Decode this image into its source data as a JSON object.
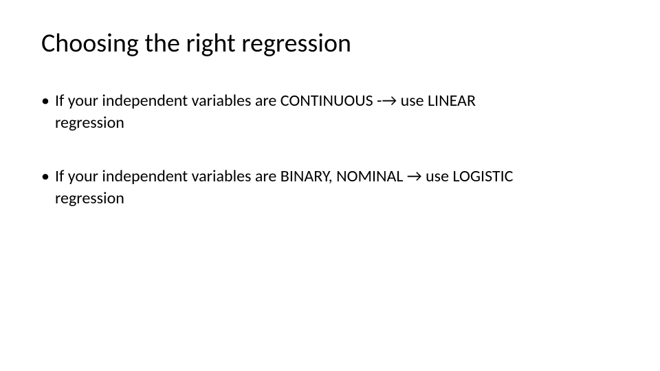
{
  "title": "Choosing the right regression",
  "bullets": [
    {
      "line1": "If your independent variables are CONTINUOUS -→ use  LINEAR",
      "line2": "regression"
    },
    {
      "line1": "If your independent variables are BINARY, NOMINAL → use LOGISTIC",
      "line2": "regression"
    }
  ]
}
